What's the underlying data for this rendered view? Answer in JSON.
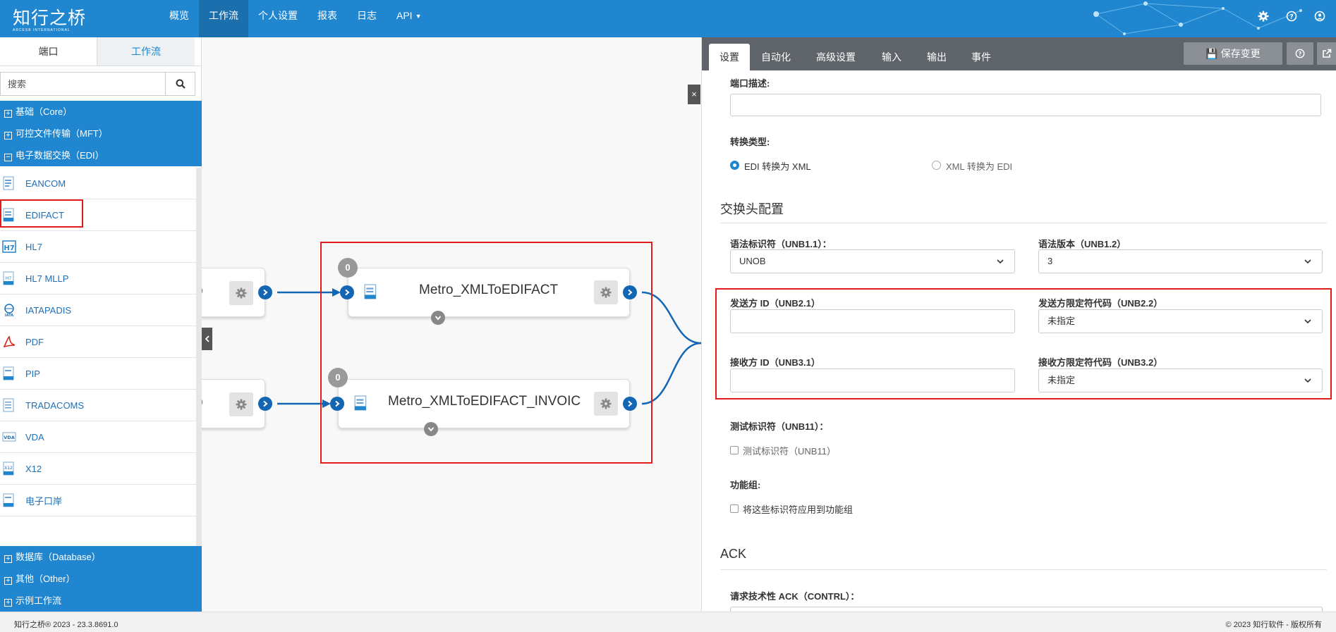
{
  "app": {
    "logo_cn": "知行之桥",
    "logo_en": "ARCESB INTERNATIONAL"
  },
  "nav": {
    "items": [
      "概览",
      "工作流",
      "个人设置",
      "报表",
      "日志",
      "API"
    ],
    "active_index": 1
  },
  "left": {
    "tabs": [
      "端口",
      "工作流"
    ],
    "search_placeholder": "搜索",
    "groups": {
      "core": "基础（Core）",
      "mft": "可控文件传输（MFT）",
      "edi": "电子数据交换（EDI）",
      "database": "数据库（Database）",
      "other": "其他（Other）",
      "samples": "示例工作流"
    },
    "edi_items": [
      "EANCOM",
      "EDIFACT",
      "HL7",
      "HL7 MLLP",
      "IATAPADIS",
      "PDF",
      "PIP",
      "TRADACOMS",
      "VDA",
      "X12",
      "电子口岸"
    ]
  },
  "canvas": {
    "node1": {
      "title": "Metro_XMLToEDIFACT",
      "badge": "0"
    },
    "node2": {
      "title": "Metro_XMLToEDIFACT_INVOIC",
      "badge": "0"
    },
    "left_node1_tail": "p",
    "left_node2_tail": "p",
    "close_label": "×"
  },
  "right": {
    "tabs": [
      "设置",
      "自动化",
      "高级设置",
      "输入",
      "输出",
      "事件"
    ],
    "save_label": "保存变更",
    "port_desc_label": "端口描述:",
    "conversion_label": "转换类型:",
    "radio_edi_to_xml": "EDI 转换为 XML",
    "radio_xml_to_edi": "XML 转换为 EDI",
    "exchange_header": "交换头配置",
    "syntax_id_label": "语法标识符（UNB1.1）：",
    "syntax_id_value": "UNOB",
    "syntax_version_label": "语法版本（UNB1.2）",
    "syntax_version_value": "3",
    "sender_id_label": "发送方 ID（UNB2.1）",
    "sender_qual_label": "发送方限定符代码（UNB2.2）",
    "sender_qual_value": "未指定",
    "receiver_id_label": "接收方 ID（UNB3.1）",
    "receiver_qual_label": "接收方限定符代码（UNB3.2）",
    "receiver_qual_value": "未指定",
    "test_indicator_label": "测试标识符（UNB11）：",
    "test_indicator_check": "测试标识符（UNB11）",
    "func_group_label": "功能组:",
    "func_group_check": "将这些标识符应用到功能组",
    "ack_section": "ACK",
    "tech_ack_label": "请求技术性 ACK（CONTRL）："
  },
  "footer": {
    "left": "知行之桥® 2023 - 23.3.8691.0",
    "right": "© 2023 知行软件 - 版权所有"
  },
  "colors": {
    "brand": "#1f86cf",
    "highlight": "#e31b1b",
    "port": "#1366b3"
  }
}
